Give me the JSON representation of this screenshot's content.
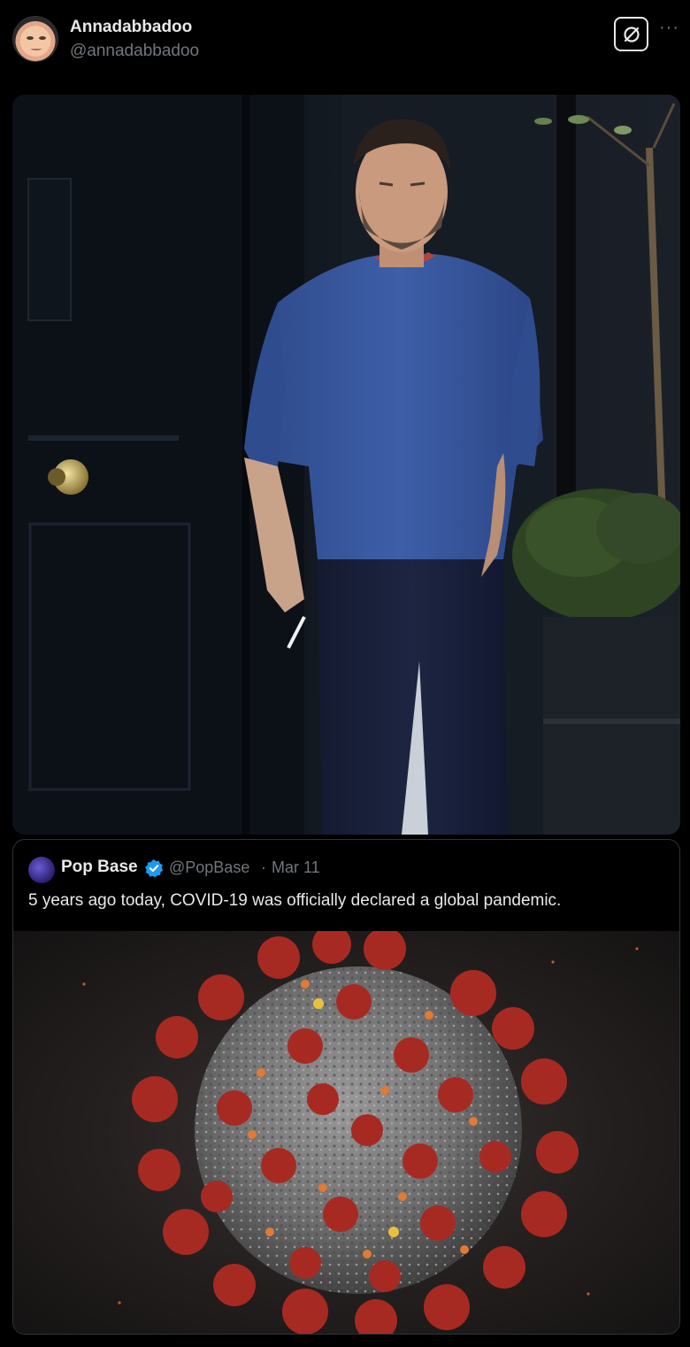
{
  "tweet": {
    "display_name": "Annadabbadoo",
    "handle": "@annadabbadoo",
    "avatar_icon": "profile-avatar",
    "grok_icon": "grok-icon",
    "more_icon": "more-horizontal-icon",
    "more_glyph": "···"
  },
  "quoted_tweet": {
    "author_name": "Pop Base",
    "verified_icon": "verified-badge-icon",
    "handle": "@PopBase",
    "separator": "·",
    "date": "Mar 11",
    "text": "5 years ago today, COVID-19 was officially declared a global pandemic."
  },
  "colors": {
    "background": "#000000",
    "text_primary": "#e7e9ea",
    "text_secondary": "#71767b",
    "border": "#2f3336",
    "verified": "#1d9bf0"
  }
}
